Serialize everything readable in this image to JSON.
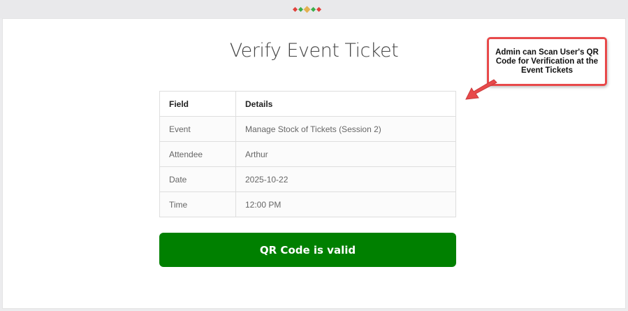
{
  "page": {
    "title": "Verify Event Ticket"
  },
  "table": {
    "headers": [
      "Field",
      "Details"
    ],
    "rows": [
      [
        "Event",
        "Manage Stock of Tickets (Session 2)"
      ],
      [
        "Attendee",
        "Arthur"
      ],
      [
        "Date",
        "2025-10-22"
      ],
      [
        "Time",
        "12:00 PM"
      ]
    ]
  },
  "status_button": {
    "label": "QR Code is valid",
    "color": "#008000"
  },
  "annotation": {
    "text": "Admin can Scan User's QR Code for Verification at the Event Tickets",
    "border_color": "#e8494a"
  },
  "icons": {
    "top_dots": "decorative-dots-icon",
    "callout_arrow": "callout-arrow-icon"
  }
}
